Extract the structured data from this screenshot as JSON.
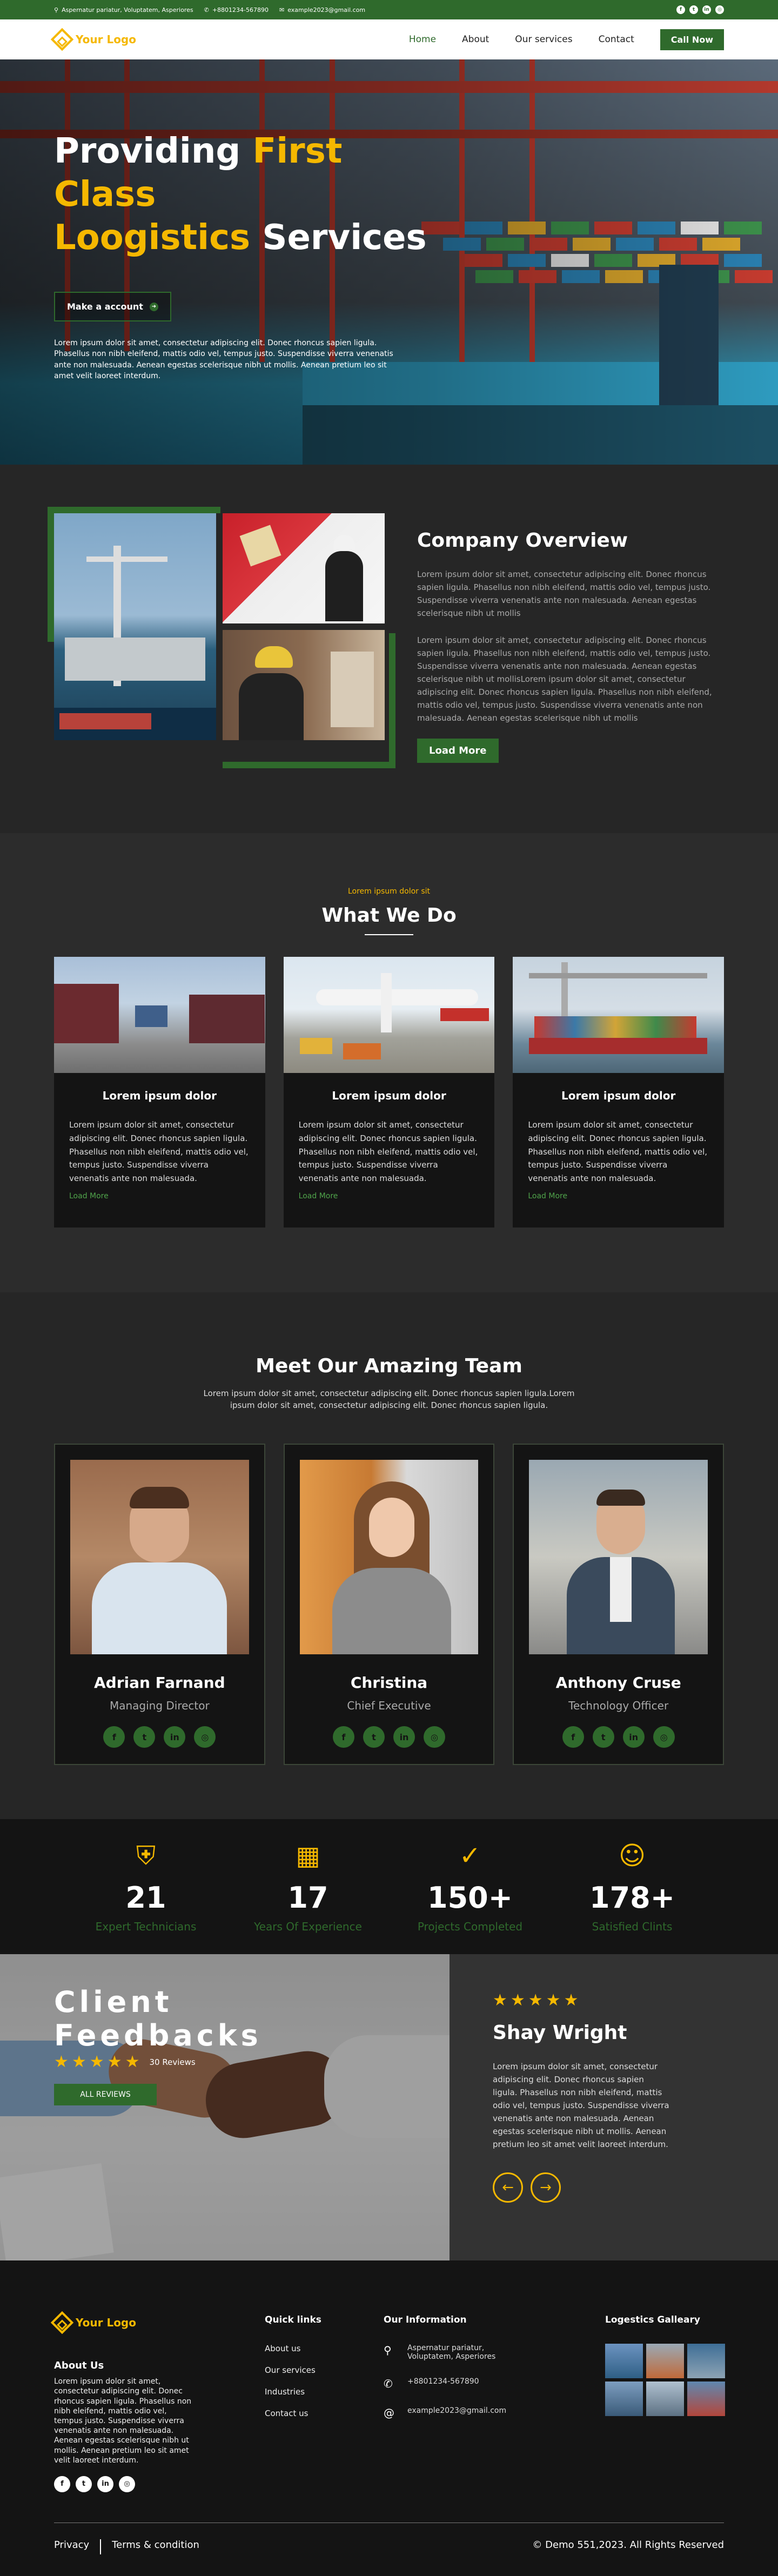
{
  "topbar": {
    "address": "Aspernatur pariatur, Voluptatem, Asperiores",
    "phone": "+8801234-567890",
    "email": "example2023@gmail.com",
    "social_icons": [
      "facebook-icon",
      "twitter-icon",
      "linkedin-icon",
      "dribbble-icon"
    ]
  },
  "nav": {
    "logo_text": "Your Logo",
    "items": [
      "Home",
      "About",
      "Our services",
      "Contact"
    ],
    "cta": "Call Now"
  },
  "hero": {
    "line1_white": "Providing ",
    "line1_yellow": "First Class",
    "line2_yellow": "Loogistics",
    "line2_white": " Services",
    "button": "Make a account",
    "text": "Lorem ipsum dolor sit amet, consectetur adipiscing elit. Donec rhoncus sapien ligula. Phasellus non nibh eleifend, mattis odio vel, tempus justo. Suspendisse viverra venenatis ante non malesuada. Aenean egestas scelerisque nibh ut mollis. Aenean pretium leo sit amet velit laoreet interdum."
  },
  "overview": {
    "title": "Company Overview",
    "p1": "Lorem ipsum dolor sit amet, consectetur adipiscing elit. Donec rhoncus sapien ligula. Phasellus non nibh eleifend, mattis odio vel, tempus justo. Suspendisse viverra venenatis ante non malesuada. Aenean egestas scelerisque nibh ut mollis",
    "p2": "Lorem ipsum dolor sit amet, consectetur adipiscing elit. Donec rhoncus sapien ligula. Phasellus non nibh eleifend, mattis odio vel, tempus justo. Suspendisse viverra venenatis ante non malesuada. Aenean egestas scelerisque nibh ut mollisLorem ipsum dolor sit amet, consectetur adipiscing elit. Donec rhoncus sapien ligula. Phasellus non nibh eleifend, mattis odio vel, tempus justo. Suspendisse viverra venenatis ante non malesuada. Aenean egestas scelerisque nibh ut mollis",
    "button": "Load More"
  },
  "what": {
    "subtitle": "Lorem ipsum dolor sit",
    "title": "What We Do",
    "cards": [
      {
        "title": "Lorem ipsum dolor",
        "text": "Lorem ipsum dolor sit amet, consectetur adipiscing elit. Donec rhoncus sapien ligula. Phasellus non nibh eleifend, mattis odio vel, tempus justo. Suspendisse viverra venenatis ante non malesuada.",
        "link": "Load More"
      },
      {
        "title": "Lorem ipsum dolor",
        "text": "Lorem ipsum dolor sit amet, consectetur adipiscing elit. Donec rhoncus sapien ligula. Phasellus non nibh eleifend, mattis odio vel, tempus justo. Suspendisse viverra venenatis ante non malesuada.",
        "link": "Load More"
      },
      {
        "title": "Lorem ipsum dolor",
        "text": "Lorem ipsum dolor sit amet, consectetur adipiscing elit. Donec rhoncus sapien ligula. Phasellus non nibh eleifend, mattis odio vel, tempus justo. Suspendisse viverra venenatis ante non malesuada.",
        "link": "Load More"
      }
    ]
  },
  "team": {
    "title": "Meet Our Amazing Team",
    "lead": "Lorem ipsum dolor sit amet, consectetur adipiscing elit. Donec rhoncus sapien ligula.Lorem ipsum dolor sit amet, consectetur adipiscing elit. Donec rhoncus sapien ligula.",
    "members": [
      {
        "name": "Adrian Farnand",
        "role": "Managing Director"
      },
      {
        "name": "Christina",
        "role": "Chief Executive"
      },
      {
        "name": "Anthony Cruse",
        "role": "Technology Officer"
      }
    ]
  },
  "stats": [
    {
      "icon": "shield-icon",
      "number": "21",
      "label": "Expert Technicians"
    },
    {
      "icon": "calendar-icon",
      "number": "17",
      "label": "Years Of Experience"
    },
    {
      "icon": "check-circle-icon",
      "number": "150+",
      "label": "Projects Completed"
    },
    {
      "icon": "smile-icon",
      "number": "178+",
      "label": "Satisfied Clints"
    }
  ],
  "testimonial": {
    "title_line1": "Client",
    "title_line2": "Feedbacks",
    "reviews": "30 Reviews",
    "button": "ALL REVIEWS",
    "name": "Shay Wright",
    "text": "Lorem ipsum dolor sit amet, consectetur adipiscing elit. Donec rhoncus sapien ligula. Phasellus non nibh eleifend, mattis odio vel, tempus justo. Suspendisse viverra venenatis ante non malesuada. Aenean egestas scelerisque nibh ut mollis. Aenean pretium leo sit amet velit laoreet interdum."
  },
  "footer": {
    "logo_text": "Your Logo",
    "about_title": "About Us",
    "about_text": "Lorem ipsum dolor sit amet, consectetur adipiscing elit. Donec rhoncus sapien ligula. Phasellus non nibh eleifend, mattis odio vel, tempus justo. Suspendisse viverra venenatis ante non malesuada. Aenean egestas scelerisque nibh ut mollis. Aenean pretium leo sit amet velit laoreet interdum.",
    "quick_title": "Quick links",
    "quick_links": [
      "About us",
      "Our services",
      "Industries",
      "Contact us"
    ],
    "info_title": "Our Information",
    "address": "Aspernatur pariatur, Voluptatem, Asperiores",
    "phone": "+8801234-567890",
    "email": "example2023@gmail.com",
    "gallery_title": "Logestics Galleary",
    "privacy": "Privacy",
    "terms": "Terms & condition",
    "copyright": "© Demo 551,2023. All Rights Reserved"
  },
  "colors": {
    "accent": "#2f6a2c",
    "highlight": "#f5b800",
    "dark": "#141414"
  }
}
